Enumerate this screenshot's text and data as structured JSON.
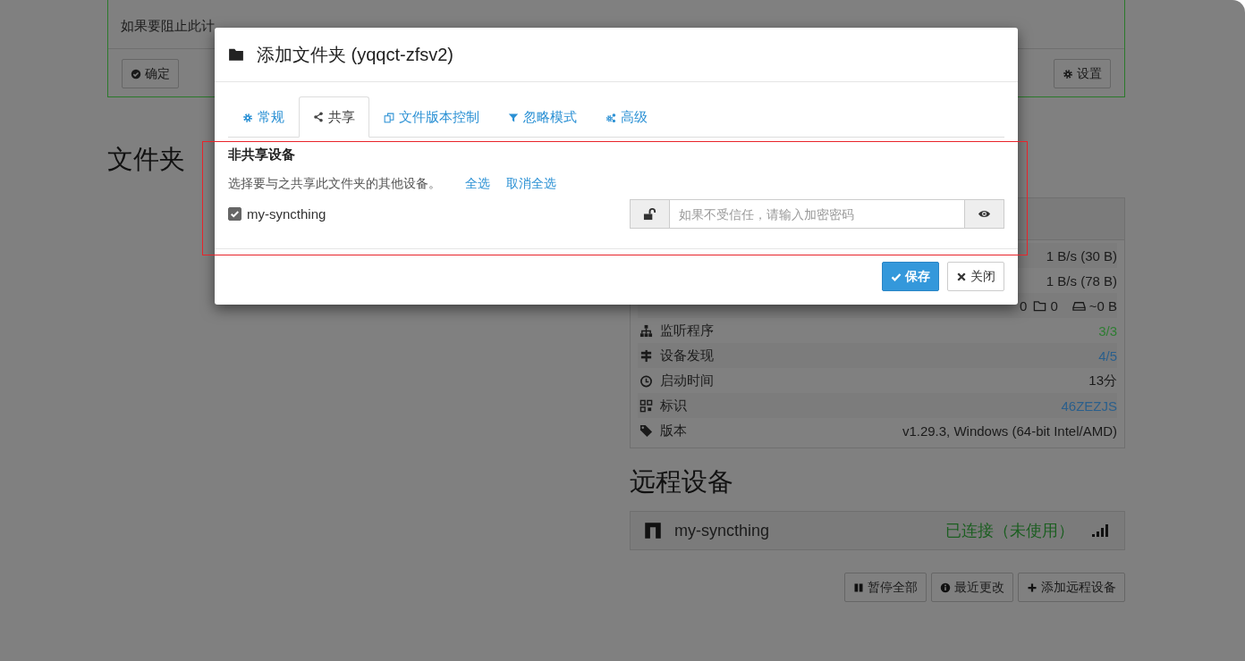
{
  "background": {
    "alert": {
      "text": "如果要阻止此计",
      "buttons": [
        {
          "label": "确定"
        },
        {
          "label": "设置"
        }
      ]
    },
    "folders_heading": "文件夹",
    "stats": [
      {
        "kind": "value",
        "value": "1 B/s (30 B)",
        "color": "#1a1a1a"
      },
      {
        "kind": "value",
        "value": "1 B/s (78 B)",
        "color": "#1a1a1a"
      },
      {
        "kind": "counts",
        "values": [
          "0",
          "0",
          "~0 B"
        ],
        "color": "#1a1a1a"
      },
      {
        "kind": "labeled",
        "label": "监听程序",
        "value": "3/3",
        "color": "#2e7d32"
      },
      {
        "kind": "labeled",
        "label": "设备发现",
        "value": "4/5",
        "color": "#2a5f8c"
      },
      {
        "kind": "labeled",
        "label": "启动时间",
        "value": "13分",
        "color": "#1a1a1a"
      },
      {
        "kind": "labeled",
        "label": "标识",
        "value": "46ZEZJS",
        "color": "#2a5f8c"
      },
      {
        "kind": "labeled",
        "label": "版本",
        "value": "v1.29.3, Windows (64-bit Intel/AMD)",
        "color": "#1a1a1a"
      }
    ],
    "remote_heading": "远程设备",
    "device": {
      "name": "my-syncthing",
      "status": "已连接（未使用）"
    },
    "buttons": [
      {
        "label": "暂停全部"
      },
      {
        "label": "最近更改"
      },
      {
        "label": "添加远程设备"
      }
    ]
  },
  "dialog": {
    "title": "添加文件夹 (yqqct-zfsv2)",
    "tabs": [
      {
        "label": "常规",
        "selected": false
      },
      {
        "label": "共享",
        "selected": true
      },
      {
        "label": "文件版本控制",
        "selected": false
      },
      {
        "label": "忽略模式",
        "selected": false
      },
      {
        "label": "高级",
        "selected": false
      }
    ],
    "section_heading": "非共享设备",
    "description": "选择要与之共享此文件夹的其他设备。",
    "links": [
      "全选",
      "取消全选"
    ],
    "devices": [
      {
        "name": "my-syncthing",
        "checked": true,
        "password_placeholder": "如果不受信任，请输入加密密码"
      }
    ],
    "buttons": [
      {
        "label": "保存",
        "primary": true
      },
      {
        "label": "关闭",
        "primary": false
      }
    ]
  }
}
